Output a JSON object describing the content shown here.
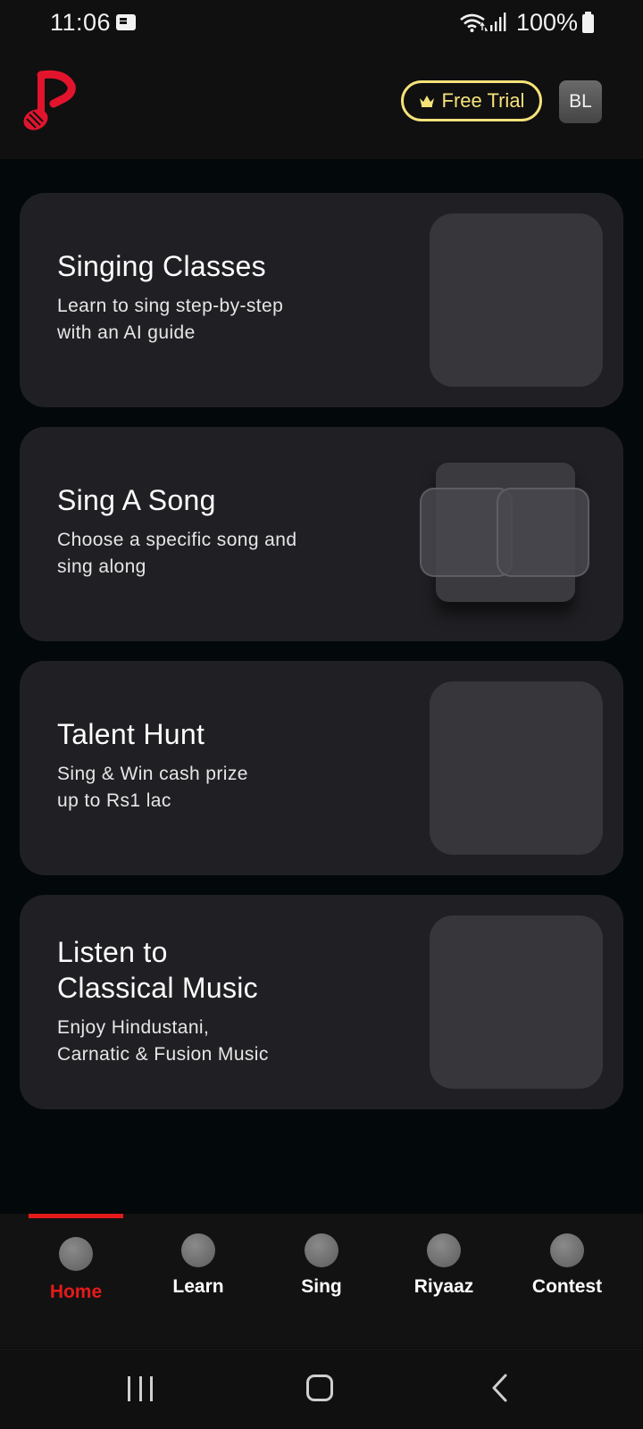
{
  "status_bar": {
    "time": "11:06",
    "battery": "100%",
    "icons": [
      "notification-icon",
      "wifi-icon",
      "signal-icon",
      "battery-icon"
    ]
  },
  "header": {
    "logo": "music-note-logo",
    "free_trial_label": "Free Trial",
    "avatar_initials": "BL",
    "accent_color": "#f6e27a",
    "brand_color": "#e2142d"
  },
  "cards": [
    {
      "title": "Singing Classes",
      "subtitle": "Learn to sing step-by-step\nwith an AI guide"
    },
    {
      "title": "Sing A Song",
      "subtitle": "Choose a specific song and\nsing along"
    },
    {
      "title": "Talent Hunt",
      "subtitle": "Sing & Win cash prize\nup to Rs1 lac"
    },
    {
      "title": "Listen to\nClassical Music",
      "subtitle": "Enjoy Hindustani,\nCarnatic & Fusion Music"
    }
  ],
  "bottom_nav": {
    "active_color": "#e51a1a",
    "items": [
      {
        "label": "Home",
        "active": true
      },
      {
        "label": "Learn",
        "active": false
      },
      {
        "label": "Sing",
        "active": false
      },
      {
        "label": "Riyaaz",
        "active": false
      },
      {
        "label": "Contest",
        "active": false
      }
    ]
  },
  "system_nav": {
    "buttons": [
      "recents-icon",
      "home-icon",
      "back-icon"
    ]
  }
}
